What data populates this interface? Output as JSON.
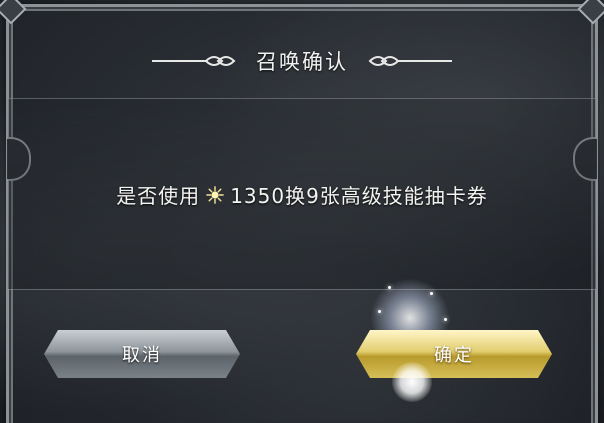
{
  "dialog": {
    "title": "召唤确认",
    "message_prefix": "是否使用",
    "currency_icon": "star-gem-icon",
    "message_suffix": "1350换9张高级技能抽卡券"
  },
  "buttons": {
    "cancel_label": "取消",
    "confirm_label": "确定"
  },
  "colors": {
    "confirm_button": "#d9c25c",
    "cancel_button": "#8e959b",
    "text": "#f4f4f2"
  }
}
